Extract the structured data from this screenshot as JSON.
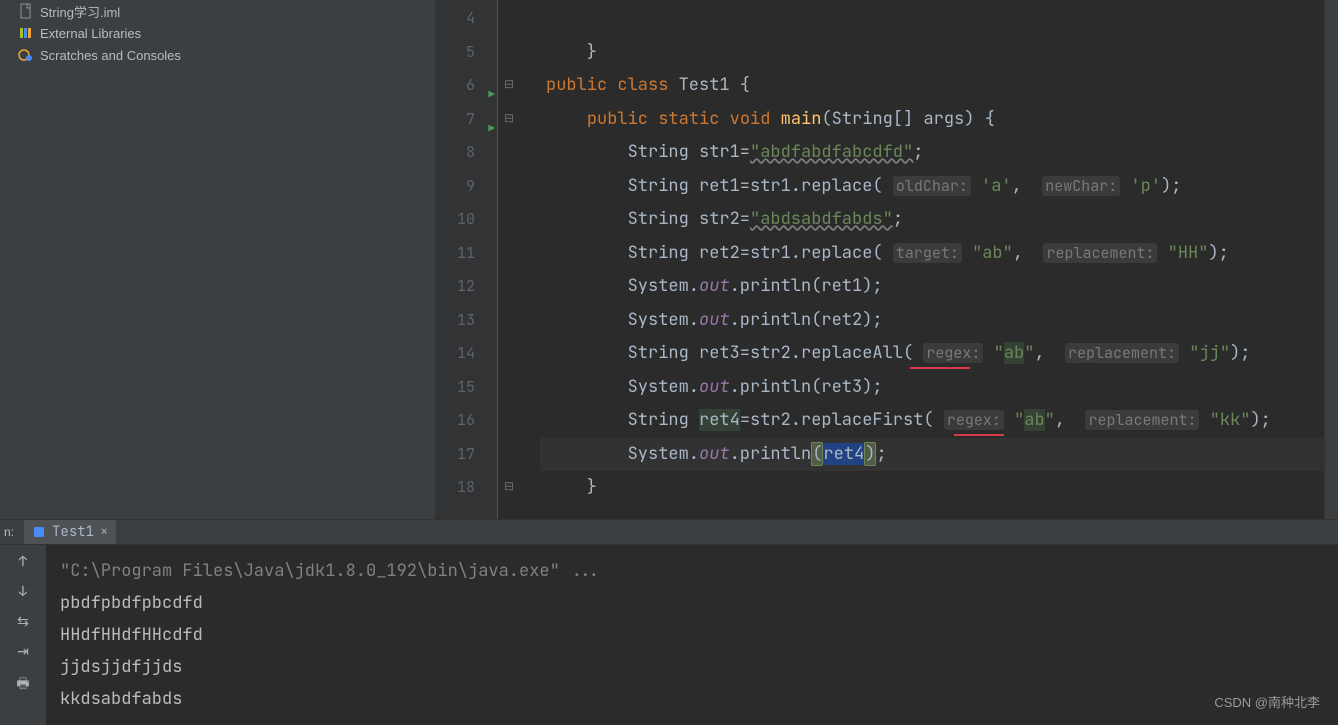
{
  "sidebar": {
    "items": [
      {
        "label": "String学习.iml",
        "icon": "file"
      },
      {
        "label": "External Libraries",
        "icon": "lib"
      },
      {
        "label": "Scratches and Consoles",
        "icon": "scratch"
      }
    ]
  },
  "gutter": {
    "lines": [
      "4",
      "5",
      "6",
      "7",
      "8",
      "9",
      "10",
      "11",
      "12",
      "13",
      "14",
      "15",
      "16",
      "17",
      "18"
    ],
    "run_markers": [
      6,
      7
    ]
  },
  "code": {
    "l4": "",
    "l5": "    }",
    "l6_kw1": "public",
    "l6_kw2": "class",
    "l6_name": "Test1",
    "l6_brace": " {",
    "l7_kw1": "public",
    "l7_kw2": "static",
    "l7_kw3": "void",
    "l7_fn": "main",
    "l7_rest": "(String[] args) {",
    "l8a": "        String str1=",
    "l8s": "\"abdfabdfabcdfd\"",
    "l8b": ";",
    "l9a": "        String ret1=str1.replace(",
    "l9h1": "oldChar:",
    "l9v1": " 'a'",
    "l9c": ", ",
    "l9h2": "newChar:",
    "l9v2": " 'p'",
    "l9b": ");",
    "l10a": "        String str2=",
    "l10s": "\"abdsabdfabds\"",
    "l10b": ";",
    "l11a": "        String ret2=str1.replace(",
    "l11h1": "target:",
    "l11v1": " \"ab\"",
    "l11c": ", ",
    "l11h2": "replacement:",
    "l11v2": " \"HH\"",
    "l11b": ");",
    "l12a": "        System.",
    "l12o": "out",
    "l12b": ".println(ret1);",
    "l13a": "        System.",
    "l13o": "out",
    "l13b": ".println(ret2);",
    "l14a": "        String ret3=str2.replaceAll(",
    "l14h1": "regex:",
    "l14v1a": " \"",
    "l14v1b": "ab",
    "l14v1c": "\"",
    "l14c": ", ",
    "l14h2": "replacement:",
    "l14v2": " \"jj\"",
    "l14b": ");",
    "l15a": "        System.",
    "l15o": "out",
    "l15b": ".println(ret3);",
    "l16a": "        String ",
    "l16v": "ret4",
    "l16a2": "=str2.replaceFirst(",
    "l16h1": "regex:",
    "l16v1a": " \"",
    "l16v1b": "ab",
    "l16v1c": "\"",
    "l16c": ", ",
    "l16h2": "replacement:",
    "l16v2": " \"kk\"",
    "l16b": ");",
    "l17a": "        System.",
    "l17o": "out",
    "l17b": ".println",
    "l17p1": "(",
    "l17v": "ret4",
    "l17p2": ")",
    "l17c": ";",
    "l18": "    }"
  },
  "run_tab": {
    "prefix": "n:",
    "name": "Test1"
  },
  "console": {
    "cmd": "\"C:\\Program Files\\Java\\jdk1.8.0_192\\bin\\java.exe\" ...",
    "out": [
      "pbdfpbdfpbcdfd",
      "HHdfHHdfHHcdfd",
      "jjdsjjdfjjds",
      "kkdsabdfabds"
    ]
  },
  "watermark": "CSDN @南种北李"
}
